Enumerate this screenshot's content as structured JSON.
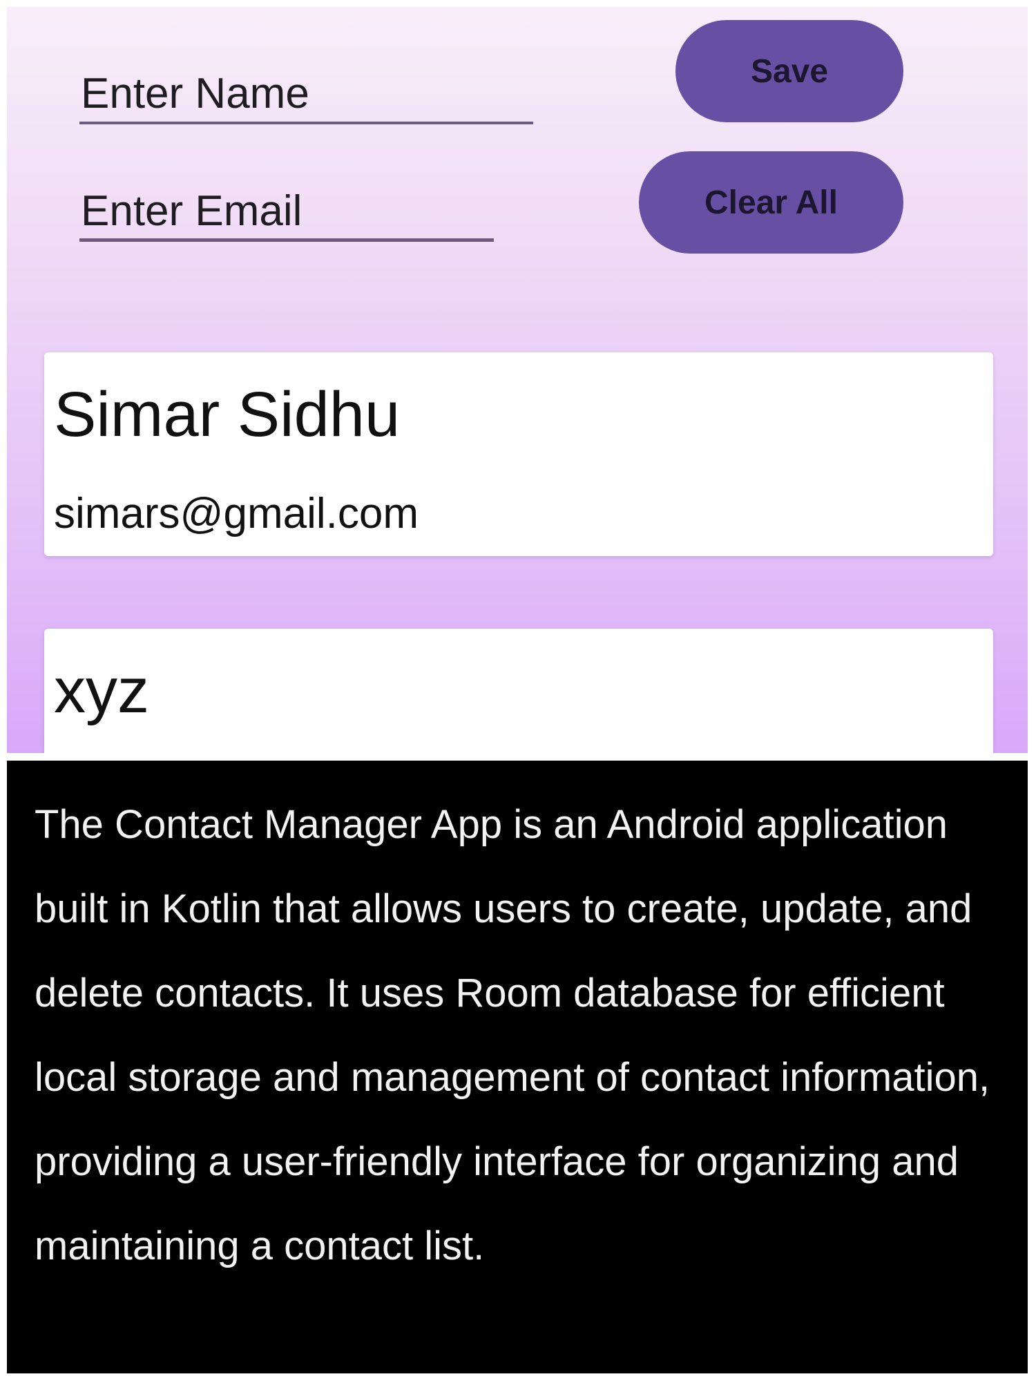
{
  "form": {
    "name_placeholder": "Enter Name",
    "email_placeholder": "Enter Email",
    "save_label": "Save",
    "clear_label": "Clear All"
  },
  "contacts": [
    {
      "name": "Simar Sidhu",
      "email": "simars@gmail.com"
    },
    {
      "name": "xyz",
      "email": ""
    }
  ],
  "description": {
    "text": "The Contact Manager App is an Android application built in Kotlin that allows users to create, update, and delete contacts. It uses Room database for efficient local storage and management of contact information, providing a user-friendly interface for organizing and maintaining a contact list."
  },
  "colors": {
    "button": "#6750a4",
    "background_top": "#f8eef9",
    "background_bottom": "#d9a8fa",
    "description_bg": "#000000"
  }
}
